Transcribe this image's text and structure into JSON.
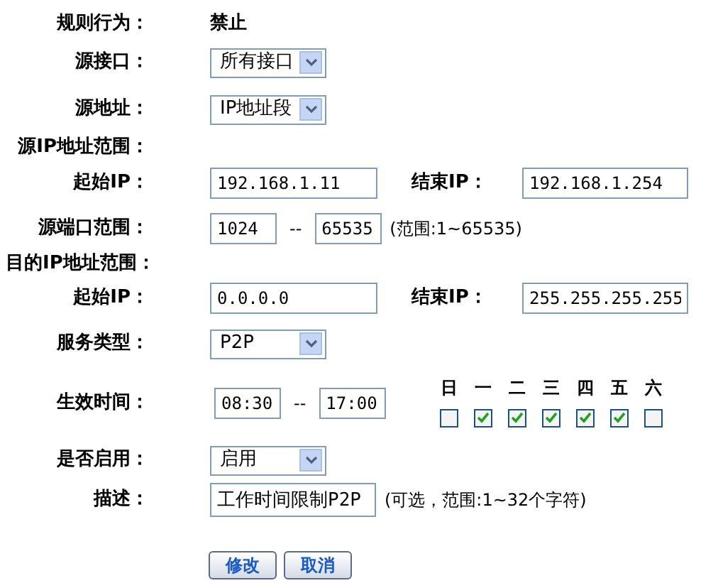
{
  "fields": [
    {
      "kind": "text",
      "label": "规则行为：",
      "value": "禁止"
    },
    {
      "kind": "select",
      "label": "源接口：",
      "value": "所有接口"
    },
    {
      "kind": "select",
      "label": "源地址：",
      "value": "IP地址段"
    },
    {
      "kind": "heading",
      "label": "源IP地址范围："
    },
    {
      "kind": "ip_range",
      "label": "起始IP：",
      "start": "192.168.1.11",
      "end_label": "结束IP：",
      "end": "192.168.1.254"
    },
    {
      "kind": "port_range",
      "label": "源端口范围：",
      "from": "1024",
      "separator": "--",
      "to": "65535",
      "hint": "(范围:1~65535)"
    },
    {
      "kind": "heading",
      "label": "目的IP地址范围："
    },
    {
      "kind": "ip_range",
      "label": "起始IP：",
      "start": "0.0.0.0",
      "end_label": "结束IP：",
      "end": "255.255.255.255"
    },
    {
      "kind": "select",
      "label": "服务类型：",
      "value": "P2P"
    },
    {
      "kind": "time",
      "label": "生效时间：",
      "from": "08:30",
      "separator": "--",
      "to": "17:00",
      "days": [
        {
          "label": "日",
          "checked": false
        },
        {
          "label": "一",
          "checked": true
        },
        {
          "label": "二",
          "checked": true
        },
        {
          "label": "三",
          "checked": true
        },
        {
          "label": "四",
          "checked": true
        },
        {
          "label": "五",
          "checked": true
        },
        {
          "label": "六",
          "checked": false
        }
      ]
    },
    {
      "kind": "select",
      "label": "是否启用：",
      "value": "启用"
    },
    {
      "kind": "input",
      "label": "描述：",
      "value": "工作时间限制P2P",
      "hint": "(可选，范围:1~32个字符)"
    }
  ],
  "buttons": [
    "修改",
    "取消"
  ]
}
